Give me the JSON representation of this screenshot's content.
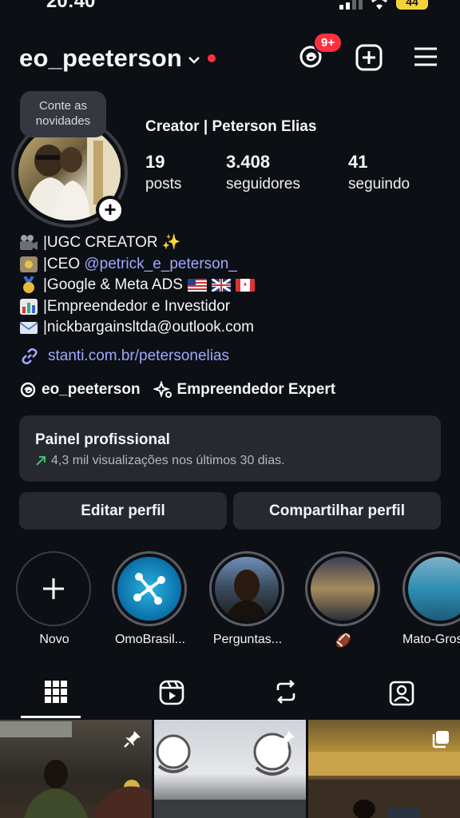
{
  "status": {
    "time": "20:40",
    "battery": "44"
  },
  "header": {
    "username": "eo_peeterson",
    "notifications": "9+"
  },
  "profile": {
    "tooltip": "Conte as novidades",
    "category_name": "Creator | Peterson Elias",
    "stats": [
      {
        "value": "19",
        "label": "posts"
      },
      {
        "value": "3.408",
        "label": "seguidores"
      },
      {
        "value": "41",
        "label": "seguindo"
      }
    ],
    "bio": {
      "line1": "|UGC CREATOR ✨",
      "line2_prefix": "|CEO ",
      "line2_mention": "@petrick_e_peterson_",
      "line3": "|Google & Meta ADS",
      "line4": "|Empreendedor e Investidor",
      "line5": "|nickbargainsltda@outlook.com"
    },
    "link": "stanti.com.br/petersonelias",
    "threads_handle": "eo_peeterson",
    "badge_label": "Empreendedor Expert"
  },
  "dashboard": {
    "title": "Painel profissional",
    "subtitle": "4,3 mil visualizações nos últimos 30 dias."
  },
  "actions": {
    "edit": "Editar perfil",
    "share": "Compartilhar perfil"
  },
  "highlights": [
    {
      "label": "Novo"
    },
    {
      "label": "OmoBrasil..."
    },
    {
      "label": "Perguntas..."
    },
    {
      "label": "🏈"
    },
    {
      "label": "Mato-Gros"
    }
  ],
  "colors": {
    "accent_link": "#a3a7ff",
    "badge_red": "#ff3040",
    "surface": "#262930",
    "background": "#0c0f14"
  }
}
